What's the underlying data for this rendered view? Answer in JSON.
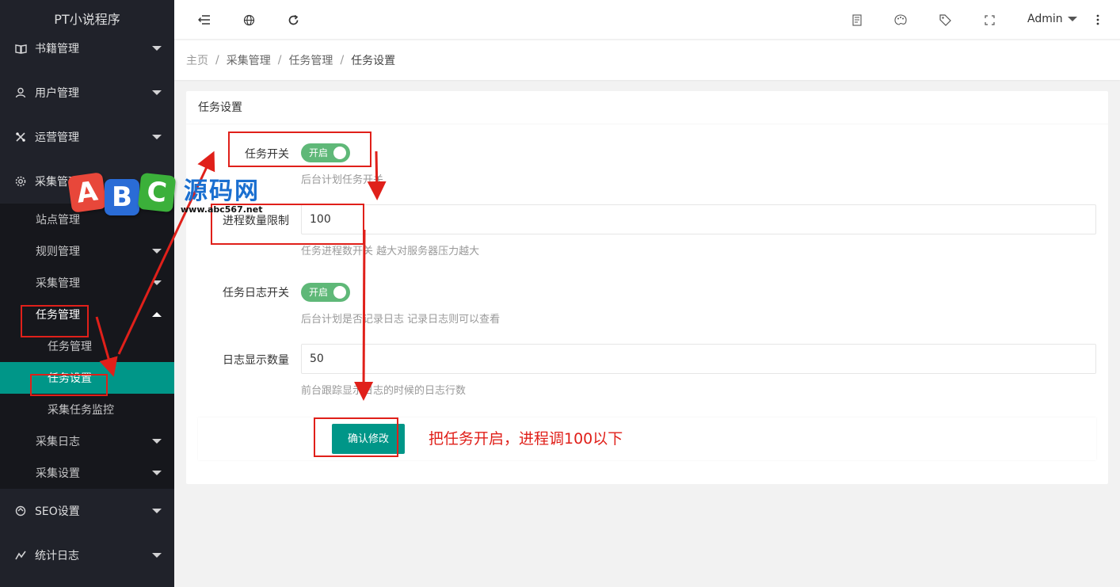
{
  "app": {
    "title": "PT小说程序"
  },
  "sidebar": {
    "items": [
      {
        "label": "书籍管理",
        "icon": "book-icon"
      },
      {
        "label": "用户管理",
        "icon": "user-icon"
      },
      {
        "label": "运营管理",
        "icon": "operation-icon"
      },
      {
        "label": "采集管理",
        "icon": "gear-icon"
      },
      {
        "label": "SEO设置",
        "icon": "seo-icon"
      },
      {
        "label": "统计日志",
        "icon": "stats-icon"
      }
    ],
    "collect_sub": [
      {
        "label": "站点管理"
      },
      {
        "label": "规则管理"
      },
      {
        "label": "采集管理"
      },
      {
        "label": "任务管理"
      },
      {
        "label": "采集日志"
      },
      {
        "label": "采集设置"
      }
    ],
    "task_sub": [
      {
        "label": "任务管理"
      },
      {
        "label": "任务设置"
      },
      {
        "label": "采集任务监控"
      }
    ]
  },
  "header": {
    "user": "Admin"
  },
  "breadcrumb": [
    "主页",
    "采集管理",
    "任务管理",
    "任务设置"
  ],
  "form": {
    "title": "任务设置",
    "task_switch": {
      "label": "任务开关",
      "state": "开启",
      "tip": "后台计划任务开关"
    },
    "process_limit": {
      "label": "进程数量限制",
      "value": "100",
      "tip": "任务进程数开关 越大对服务器压力越大"
    },
    "log_switch": {
      "label": "任务日志开关",
      "state": "开启",
      "tip": "后台计划是否记录日志 记录日志则可以查看"
    },
    "log_count": {
      "label": "日志显示数量",
      "value": "50",
      "tip": "前台跟踪显示日志的时候的日志行数"
    },
    "submit": "确认修改"
  },
  "annotation": {
    "note": "把任务开启，进程调100以下"
  },
  "watermark": {
    "letters": [
      "A",
      "B",
      "C"
    ],
    "text": "源码网",
    "url": "www.abc567.net"
  },
  "colors": {
    "accent": "#009688",
    "switch_on": "#5fb878",
    "sidebar_bg": "#20222a",
    "annotation": "#e0201a"
  }
}
